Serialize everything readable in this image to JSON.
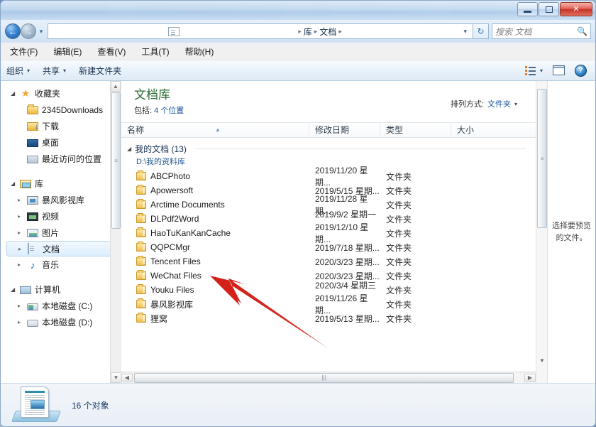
{
  "window": {
    "controls": {
      "minimize": "minimize-button",
      "restore": "restore-button",
      "close": "✕"
    }
  },
  "addressbar": {
    "back": "←",
    "forward": "→",
    "history_caret": "▾",
    "root_icon": "document-library-icon",
    "crumbs": [
      "库",
      "文档"
    ],
    "separator": "▸",
    "dropdown_caret": "▾",
    "refresh": "↻"
  },
  "search": {
    "placeholder": "搜索 文档",
    "icon": "🔍"
  },
  "menubar": {
    "items": [
      "文件(F)",
      "编辑(E)",
      "查看(V)",
      "工具(T)",
      "帮助(H)"
    ]
  },
  "toolbar": {
    "organize": "组织",
    "share": "共享",
    "new_folder": "新建文件夹",
    "caret": "▾",
    "view_options": "view-options-icon",
    "preview_pane": "preview-pane-icon",
    "help": "?"
  },
  "sidebar": {
    "groups": [
      {
        "label": "收藏夹",
        "icon": "star-icon",
        "expanded": true,
        "items": [
          {
            "label": "2345Downloads",
            "icon": "folder-icon"
          },
          {
            "label": "下载",
            "icon": "downloads-icon"
          },
          {
            "label": "桌面",
            "icon": "desktop-icon"
          },
          {
            "label": "最近访问的位置",
            "icon": "recent-places-icon"
          }
        ]
      },
      {
        "label": "库",
        "icon": "library-icon",
        "expanded": true,
        "items": [
          {
            "label": "暴风影视库",
            "icon": "video-library-icon",
            "selected": false
          },
          {
            "label": "视频",
            "icon": "film-icon",
            "selected": false
          },
          {
            "label": "图片",
            "icon": "picture-icon",
            "selected": false
          },
          {
            "label": "文档",
            "icon": "document-icon",
            "selected": true
          },
          {
            "label": "音乐",
            "icon": "music-note-icon",
            "selected": false
          }
        ]
      },
      {
        "label": "计算机",
        "icon": "computer-icon",
        "expanded": true,
        "items": [
          {
            "label": "本地磁盘 (C:)",
            "icon": "system-drive-icon"
          },
          {
            "label": "本地磁盘 (D:)",
            "icon": "drive-icon"
          }
        ]
      }
    ],
    "expand_triangle": "▸",
    "collapse_triangle": "◢"
  },
  "library": {
    "title": "文档库",
    "subtitle_prefix": "包括:",
    "subtitle_link": "4 个位置",
    "arrange_label": "排列方式:",
    "arrange_value": "文件夹",
    "arrange_caret": "▾"
  },
  "columns": [
    {
      "key": "name",
      "label": "名称",
      "sorted": true,
      "sort_mark": "▲"
    },
    {
      "key": "date",
      "label": "修改日期"
    },
    {
      "key": "type",
      "label": "类型"
    },
    {
      "key": "size",
      "label": "大小"
    }
  ],
  "group": {
    "triangle": "◢",
    "name": "我的文档 (13)",
    "path": "D:\\我的资料库"
  },
  "files": [
    {
      "name": "ABCPhoto",
      "date": "2019/11/20 星期...",
      "type": "文件夹",
      "size": ""
    },
    {
      "name": "Apowersoft",
      "date": "2019/5/15 星期...",
      "type": "文件夹",
      "size": ""
    },
    {
      "name": "Arctime Documents",
      "date": "2019/11/28 星期...",
      "type": "文件夹",
      "size": ""
    },
    {
      "name": "DLPdf2Word",
      "date": "2019/9/2 星期一 ...",
      "type": "文件夹",
      "size": ""
    },
    {
      "name": "HaoTuKanKanCache",
      "date": "2019/12/10 星期...",
      "type": "文件夹",
      "size": ""
    },
    {
      "name": "QQPCMgr",
      "date": "2019/7/18 星期...",
      "type": "文件夹",
      "size": ""
    },
    {
      "name": "Tencent Files",
      "date": "2020/3/23 星期...",
      "type": "文件夹",
      "size": ""
    },
    {
      "name": "WeChat Files",
      "date": "2020/3/23 星期...",
      "type": "文件夹",
      "size": ""
    },
    {
      "name": "Youku Files",
      "date": "2020/3/4 星期三 ...",
      "type": "文件夹",
      "size": ""
    },
    {
      "name": "暴风影视库",
      "date": "2019/11/26 星期...",
      "type": "文件夹",
      "size": ""
    },
    {
      "name": "狸窝",
      "date": "2019/5/13 星期...",
      "type": "文件夹",
      "size": ""
    }
  ],
  "preview": {
    "text": "选择要预览的文件。"
  },
  "statusbar": {
    "count_text": "16 个对象",
    "icon": "document-library-icon"
  },
  "annotation": {
    "type": "red-arrow",
    "points_to": "Tencent Files",
    "color": "#d32018"
  },
  "scrollbars": {
    "sidebar_up": "▲",
    "sidebar_down": "▼",
    "list_up": "▲",
    "list_down": "▼",
    "h_left": "◀",
    "h_right": "▶",
    "grip": "|||"
  }
}
